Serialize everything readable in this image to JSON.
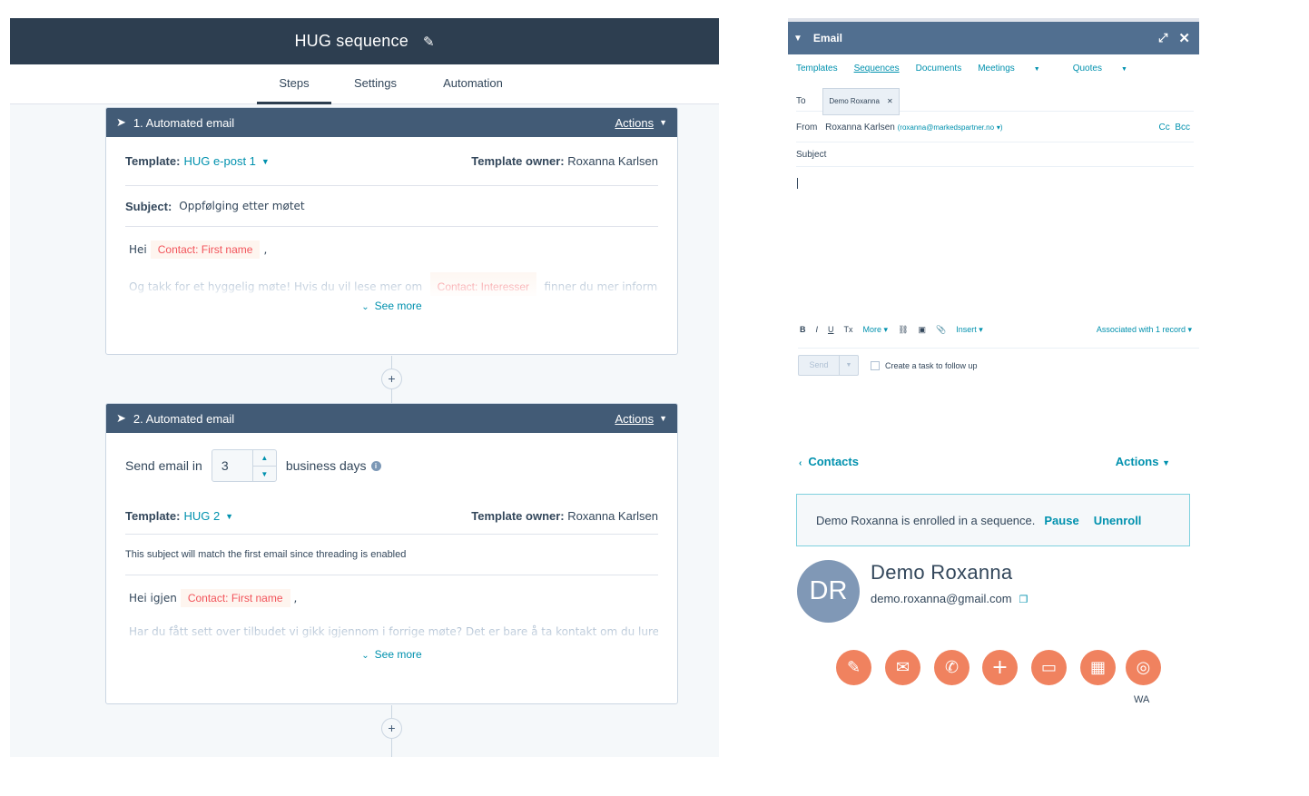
{
  "sequence": {
    "title": "HUG sequence",
    "tabs": [
      {
        "label": "Steps",
        "active": true
      },
      {
        "label": "Settings",
        "active": false
      },
      {
        "label": "Automation",
        "active": false
      }
    ]
  },
  "steps": [
    {
      "header": "1. Automated email",
      "actions_label": "Actions",
      "template_label": "Template:",
      "template_name": "HUG e-post 1",
      "owner_label": "Template owner:",
      "owner_name": "Roxanna Karlsen",
      "subject_label": "Subject:",
      "subject_value": "Oppfølging etter møtet",
      "greeting": "Hei",
      "token": "Contact: First name",
      "comma": ",",
      "preview_before": "Og takk for et hyggelig møte! Hvis du vil lese mer om",
      "preview_token": "Contact: Interesser",
      "preview_after": "finner du mer informasjon",
      "see_more": "See more"
    },
    {
      "header": "2. Automated email",
      "actions_label": "Actions",
      "send_in_label": "Send email in",
      "send_in_value": "3",
      "days_label": "business days",
      "template_label": "Template:",
      "template_name": "HUG 2",
      "owner_label": "Template owner:",
      "owner_name": "Roxanna Karlsen",
      "threading_note": "This subject will match the first email since threading is enabled",
      "greeting": "Hei igjen",
      "token": "Contact: First name",
      "comma": ",",
      "preview": "Har du fått sett over tilbudet vi gikk igjennom i forrige møte? Det er bare å ta kontakt om du lurer på noe",
      "see_more": "See more"
    }
  ],
  "email": {
    "title": "Email",
    "nav": [
      "Templates",
      "Sequences",
      "Documents",
      "Meetings",
      "Quotes"
    ],
    "to_label": "To",
    "to_chip": "Demo Roxanna",
    "from_label": "From",
    "from_name": "Roxanna Karlsen",
    "from_email": "(roxanna@markedspartner.no",
    "cc": "Cc",
    "bcc": "Bcc",
    "subject_label": "Subject",
    "toolbar": {
      "bold": "B",
      "italic": "I",
      "underline": "U",
      "clear": "Tx",
      "more": "More",
      "insert": "Insert",
      "associated": "Associated with 1 record"
    },
    "send_label": "Send",
    "task_label": "Create a task to follow up"
  },
  "contact": {
    "back_label": "Contacts",
    "actions_label": "Actions",
    "enroll_text": "Demo Roxanna is enrolled in a sequence.",
    "pause_label": "Pause",
    "unenroll_label": "Unenroll",
    "initials": "DR",
    "name": "Demo Roxanna",
    "email": "demo.roxanna@gmail.com",
    "action_icons": [
      "note-icon",
      "email-icon",
      "call-icon",
      "add-icon",
      "log-icon",
      "meeting-icon",
      "whatsapp-icon"
    ],
    "wa_label": "WA"
  },
  "colors": {
    "header_dark": "#2d3e50",
    "card_header": "#425b76",
    "email_header": "#516f90",
    "link": "#0091ae",
    "token_text": "#f2545b",
    "action_orange": "#f0825f"
  }
}
